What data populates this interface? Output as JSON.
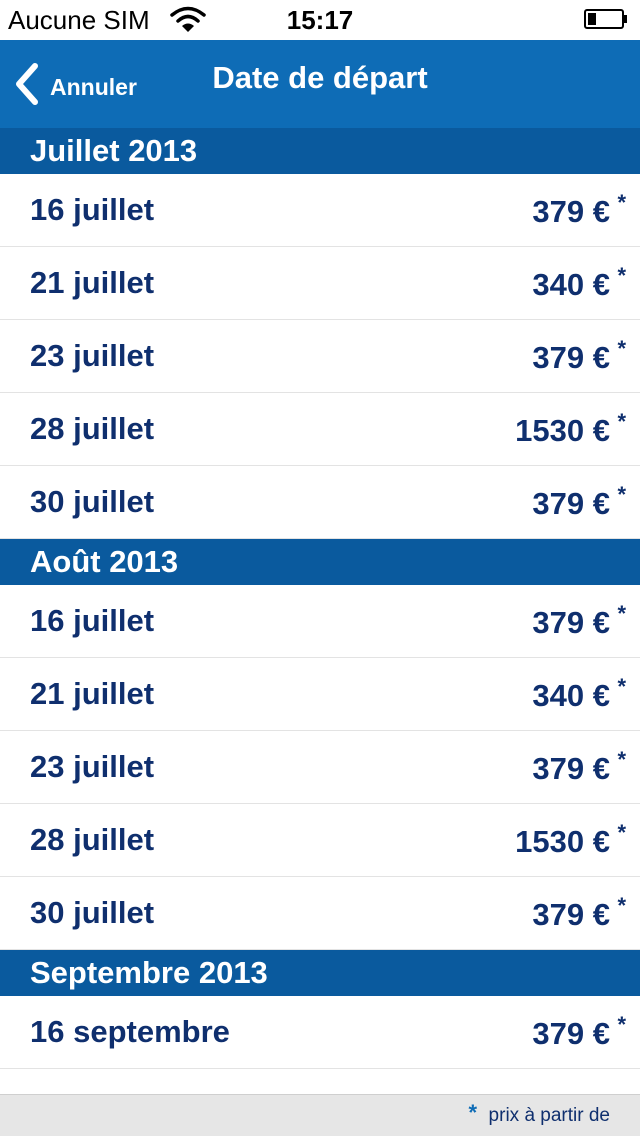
{
  "status_bar": {
    "carrier": "Aucune SIM",
    "time": "15:17"
  },
  "nav": {
    "back_label": "Annuler",
    "title": "Date de départ"
  },
  "sections": [
    {
      "title": "Juillet 2013",
      "rows": [
        {
          "date": "16 juillet",
          "price": "379 €",
          "star": "*"
        },
        {
          "date": "21 juillet",
          "price": "340 €",
          "star": "*"
        },
        {
          "date": "23 juillet",
          "price": "379 €",
          "star": "*"
        },
        {
          "date": "28 juillet",
          "price": "1530 €",
          "star": "*"
        },
        {
          "date": "30 juillet",
          "price": "379 €",
          "star": "*"
        }
      ]
    },
    {
      "title": "Août 2013",
      "rows": [
        {
          "date": "16 juillet",
          "price": "379 €",
          "star": "*"
        },
        {
          "date": "21 juillet",
          "price": "340 €",
          "star": "*"
        },
        {
          "date": "23 juillet",
          "price": "379 €",
          "star": "*"
        },
        {
          "date": "28 juillet",
          "price": "1530 €",
          "star": "*"
        },
        {
          "date": "30 juillet",
          "price": "379 €",
          "star": "*"
        }
      ]
    },
    {
      "title": "Septembre 2013",
      "rows": [
        {
          "date": "16 septembre",
          "price": "379 €",
          "star": "*"
        }
      ]
    }
  ],
  "footer": {
    "star": "*",
    "note": "prix à partir de"
  },
  "colors": {
    "nav_bar": "#0e6cb6",
    "section_header": "#0a5a9e",
    "row_text": "#0f2f6e",
    "footer_bg": "#e6e6e6"
  },
  "icons": {
    "back": "chevron-left-icon",
    "wifi": "wifi-icon",
    "battery": "battery-icon"
  }
}
